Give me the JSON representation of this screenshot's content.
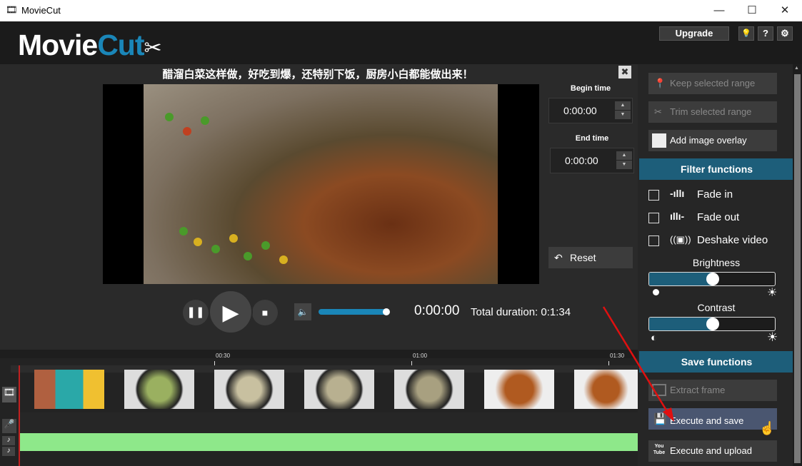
{
  "window": {
    "title": "MovieCut",
    "minimize": "—",
    "maximize": "☐",
    "close": "✕"
  },
  "header": {
    "logo_movie": "Movie",
    "logo_cut": "Cut",
    "upgrade": "Upgrade",
    "bulb": "💡",
    "help": "?",
    "settings": "⚙"
  },
  "video": {
    "title": "醋溜白菜这样做，好吃到爆，还特别下饭，厨房小白都能做出来！",
    "close": "✖"
  },
  "trim": {
    "begin_label": "Begin time",
    "begin_value": "0:00:00",
    "end_label": "End time",
    "end_value": "0:00:00",
    "reset": "Reset"
  },
  "player": {
    "time": "0:00:00",
    "total": "Total duration: 0:1:34",
    "volume_percent": 95
  },
  "timeline": {
    "ticks": [
      "00:30",
      "01:00",
      "01:30"
    ]
  },
  "actions": {
    "keep": "Keep selected range",
    "trim": "Trim selected range",
    "overlay": "Add image overlay"
  },
  "filters": {
    "title": "Filter functions",
    "fade_in": "Fade in",
    "fade_out": "Fade out",
    "deshake": "Deshake video",
    "brightness": "Brightness",
    "brightness_percent": 50,
    "contrast": "Contrast",
    "contrast_percent": 50
  },
  "save": {
    "title": "Save functions",
    "extract": "Extract frame",
    "execute_save": "Execute and save",
    "execute_upload": "Execute and upload",
    "youtube_icon_text": "You Tube"
  }
}
